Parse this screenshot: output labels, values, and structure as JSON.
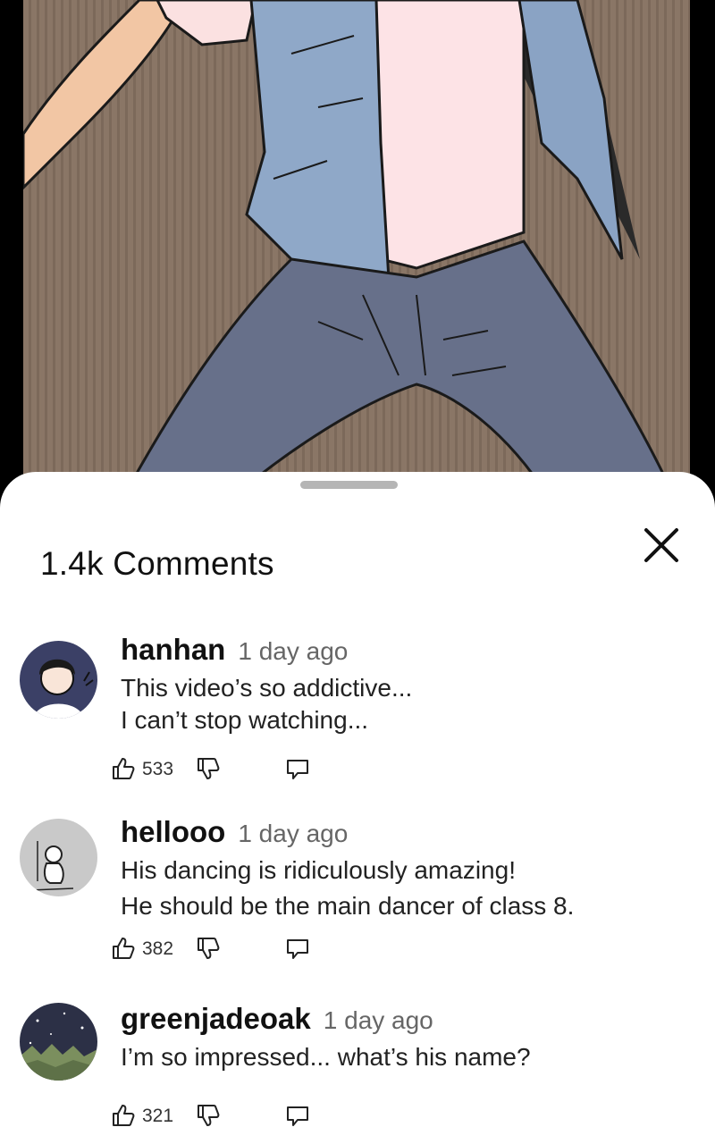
{
  "comments_header": {
    "title": "1.4k Comments"
  },
  "comments": [
    {
      "username": "hanhan",
      "time": "1 day ago",
      "lines": [
        "This video’s so addictive...",
        "I can’t stop watching..."
      ],
      "likes": "533"
    },
    {
      "username": "hellooo",
      "time": "1 day ago",
      "lines": [
        "His dancing is ridiculously amazing!",
        "He should be the main dancer of class 8."
      ],
      "likes": "382"
    },
    {
      "username": "greenjadeoak",
      "time": "1 day ago",
      "lines": [
        "I’m so impressed... what’s his name?"
      ],
      "likes": "321"
    }
  ],
  "icons": {
    "close": "close-icon",
    "like": "thumbs-up-icon",
    "dislike": "thumbs-down-icon",
    "reply": "reply-icon"
  }
}
